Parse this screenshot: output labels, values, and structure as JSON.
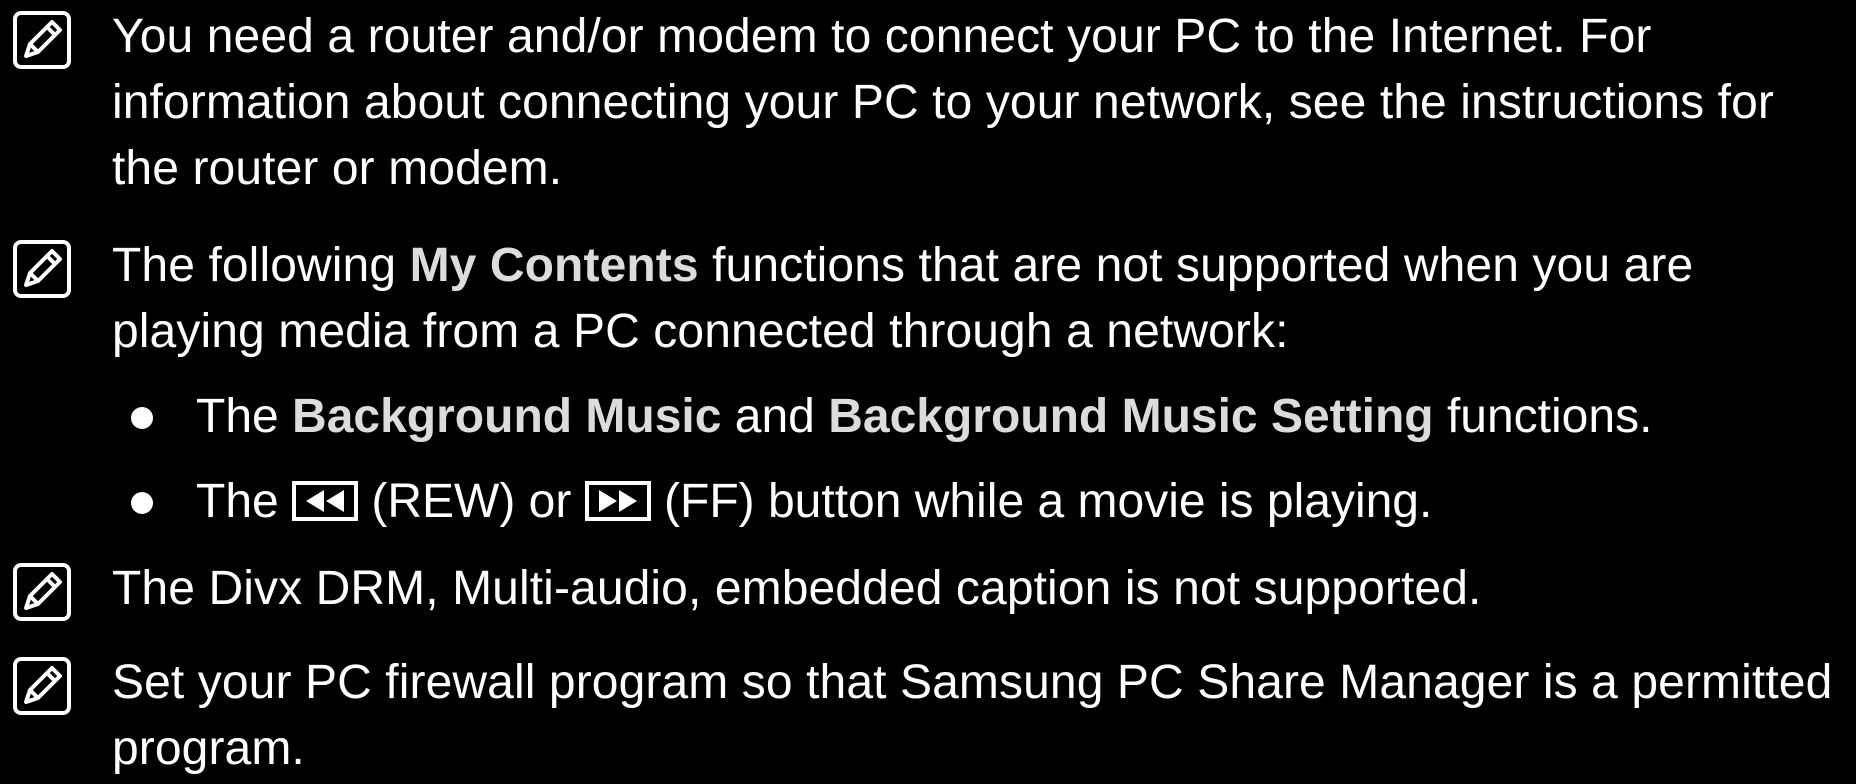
{
  "notes": [
    {
      "text": "You need a router and/or modem to connect your PC to the Internet. For information about connecting your PC to your network, see the instructions for the router or modem."
    },
    {
      "before": "The following ",
      "bold": "My Contents",
      "after": " functions that are not supported when you are playing media from a PC connected through a network:",
      "bullets": [
        {
          "t1": "The ",
          "b1": "Background Music",
          "t2": " and ",
          "b2": "Background Music Setting",
          "t3": " functions."
        },
        {
          "t1": "The ",
          "rew_label": " (REW) or ",
          "ff_label": " (FF) button while a movie is playing."
        }
      ]
    },
    {
      "text": "The Divx DRM, Multi-audio, embedded caption is not supported."
    },
    {
      "text": "Set your PC firewall program so that Samsung PC Share Manager is a permitted program."
    }
  ],
  "icons": {
    "note": "note-pencil-icon",
    "rewind": "rewind-icon",
    "fast_forward": "fast-forward-icon"
  }
}
